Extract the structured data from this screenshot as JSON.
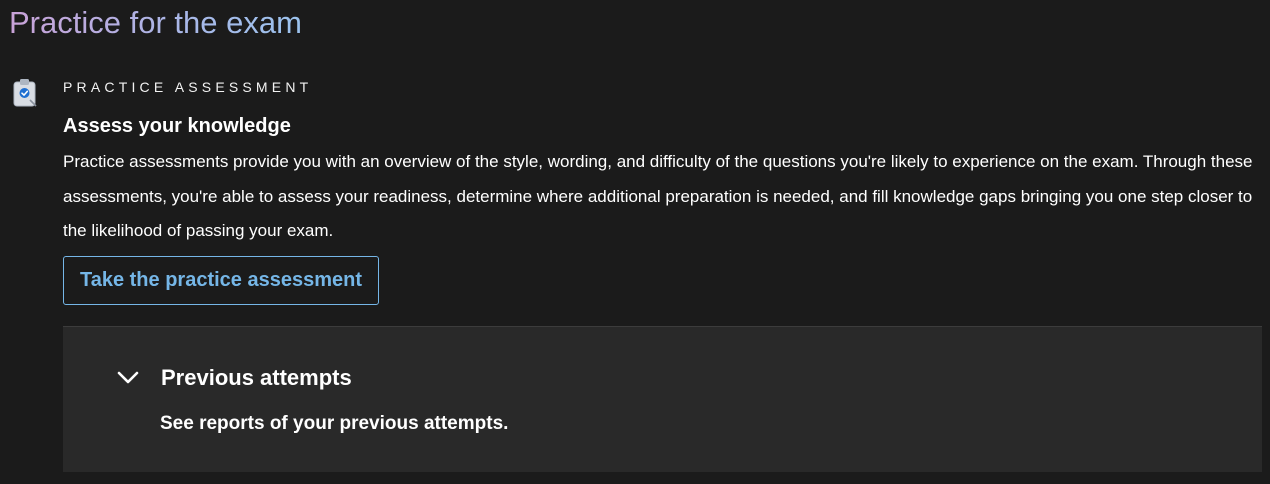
{
  "page": {
    "title": "Practice for the exam"
  },
  "assessment": {
    "icon": "clipboard-check-icon",
    "eyebrow": "PRACTICE ASSESSMENT",
    "heading": "Assess your knowledge",
    "description": "Practice assessments provide you with an overview of the style, wording, and difficulty of the questions you're likely to experience on the exam. Through these assessments, you're able to assess your readiness, determine where additional preparation is needed, and fill knowledge gaps bringing you one step closer to the likelihood of passing your exam.",
    "cta_label": "Take the practice assessment"
  },
  "previous_attempts": {
    "icon": "chevron-down-icon",
    "label": "Previous attempts",
    "subtitle": "See reports of your previous attempts."
  },
  "colors": {
    "background": "#1b1b1b",
    "panel": "#292929",
    "accent": "#75b6e7",
    "title_gradient_start": "#c9a2d8",
    "title_gradient_end": "#9cc3ee"
  }
}
